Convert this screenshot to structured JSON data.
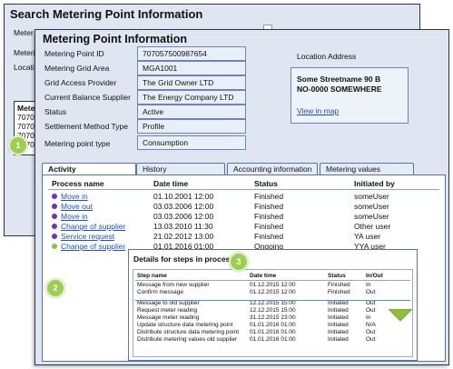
{
  "back_window": {
    "title": "Search Metering Point Information",
    "labels": [
      "Meter",
      "Meteri",
      "Locatio"
    ],
    "list_items": [
      "Meterin",
      "70705",
      "70705",
      "70705",
      "70705"
    ]
  },
  "front_window": {
    "title": "Metering Point Information",
    "fields": [
      {
        "label": "Metering Point ID",
        "value": "707057500987654"
      },
      {
        "label": "Metering Grid Area",
        "value": "MGA1001"
      },
      {
        "label": "Grid Access Provider",
        "value": "The Grid Owner LTD"
      },
      {
        "label": "Current Balance Supplier",
        "value": "The Energy Company LTD"
      },
      {
        "label": "Status",
        "value": "Active"
      },
      {
        "label": "Settlement Method Type",
        "value": "Profile"
      },
      {
        "label": "Metering point type",
        "value": "Consumption"
      }
    ],
    "location": {
      "heading": "Location Address",
      "line1": "Some Streetname 90 B",
      "line2": "NO-0000 SOMEWHERE",
      "map_link": "View in map"
    }
  },
  "callouts": [
    "1",
    "2",
    "3"
  ],
  "tabs": [
    "Activity",
    "History",
    "Accounting information",
    "Metering values"
  ],
  "activity": {
    "headers": [
      "Process name",
      "Date time",
      "Status",
      "Initiated by"
    ],
    "rows": [
      {
        "process": "Move in",
        "datetime": "01.10.2001 12:00",
        "status": "Finished",
        "by": "someUser",
        "color": "#7b2fb5"
      },
      {
        "process": "Move out",
        "datetime": "03.03.2006 12:00",
        "status": "Finished",
        "by": "someUser",
        "color": "#7b2fb5"
      },
      {
        "process": "Move in",
        "datetime": "03.03.2006 12:00",
        "status": "Finished",
        "by": "someUser",
        "color": "#7b2fb5"
      },
      {
        "process": "Change of supplier",
        "datetime": "13.03.2010 11:30",
        "status": "Finished",
        "by": "Other user",
        "color": "#7b2fb5"
      },
      {
        "process": "Service request",
        "datetime": "21.02.2012 13:00",
        "status": "Finished",
        "by": "YA user",
        "color": "#7b2fb5"
      },
      {
        "process": "Change of supplier",
        "datetime": "01.01.2016 01:00",
        "status": "Ongoing",
        "by": "YYA user",
        "color": "#8fbf3a"
      }
    ]
  },
  "details": {
    "title": "Details for steps in process",
    "headers": [
      "Step name",
      "Date time",
      "Status",
      "In/Out"
    ],
    "rows": [
      {
        "step": "Message from new supplier",
        "datetime": "01.12.2015 12:00",
        "status": "Finished",
        "inout": "In"
      },
      {
        "step": "Confirm message",
        "datetime": "01.12.2015 12:00",
        "status": "Finished",
        "inout": "Out"
      },
      {
        "step": "Message to old supplier",
        "datetime": "12.12.2015 15:00",
        "status": "Initiated",
        "inout": "Out"
      },
      {
        "step": "Request meter reading",
        "datetime": "12.12.2015 15:00",
        "status": "Initiated",
        "inout": "Out"
      },
      {
        "step": "Message meter reading",
        "datetime": "31.12.2015 23:00",
        "status": "Initiated",
        "inout": "In"
      },
      {
        "step": "Update structure data metering point",
        "datetime": "01.01.2016 01:00",
        "status": "Initiated",
        "inout": "N/A"
      },
      {
        "step": "Distribute structure data metering point",
        "datetime": "01.01.2016 01:00",
        "status": "Initiated",
        "inout": "Out"
      },
      {
        "step": "Distribute metering values old supplier",
        "datetime": "01.01.2016 01:00",
        "status": "Initiated",
        "inout": "Out"
      }
    ]
  },
  "colors": {
    "window_bg": "#dfe6f1",
    "link": "#1f4fc8",
    "callout_green": "#9bcf52",
    "ongoing_dot": "#8fbf3a",
    "finished_dot": "#7b2fb5"
  },
  "icons": [
    "down-arrow-icon",
    "status-dot-icon"
  ]
}
